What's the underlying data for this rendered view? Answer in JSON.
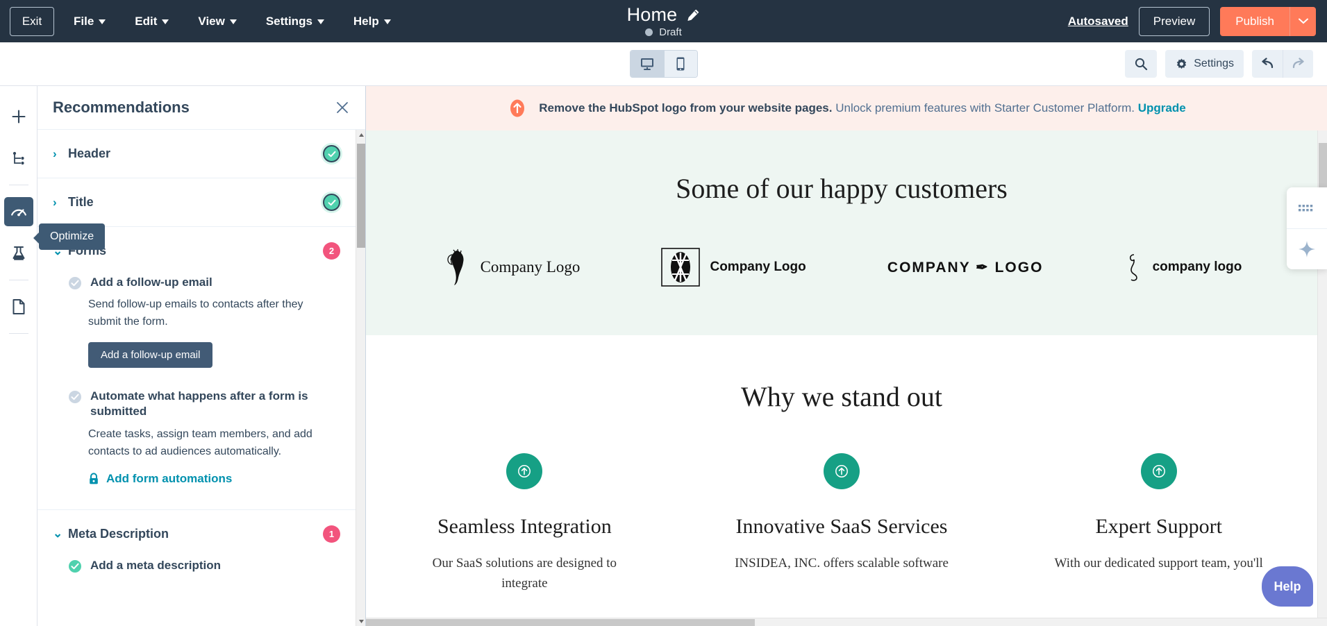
{
  "top_nav": {
    "exit_label": "Exit",
    "menus": [
      "File",
      "Edit",
      "View",
      "Settings",
      "Help"
    ],
    "page_title": "Home",
    "status": "Draft",
    "autosaved_label": "Autosaved",
    "preview_label": "Preview",
    "publish_label": "Publish"
  },
  "toolbar": {
    "device_desktop": "desktop-view",
    "device_mobile": "mobile-view",
    "settings_label": "Settings"
  },
  "rail": {
    "items": [
      "add-icon",
      "site-tree-icon",
      "optimize-gauge-icon",
      "ab-test-flask-icon",
      "file-icon"
    ]
  },
  "tooltip": {
    "optimize": "Optimize"
  },
  "recommendations": {
    "title": "Recommendations",
    "sections": [
      {
        "name": "Header",
        "state": "complete",
        "expanded": false
      },
      {
        "name": "Title",
        "state": "complete",
        "expanded": false
      },
      {
        "name": "Forms",
        "state": "badge",
        "badge": "2",
        "expanded": true
      },
      {
        "name": "Meta Description",
        "state": "badge",
        "badge": "1",
        "expanded": true
      }
    ],
    "forms_items": [
      {
        "title": "Add a follow-up email",
        "description": "Send follow-up emails to contacts after they submit the form.",
        "cta": "Add a follow-up email"
      },
      {
        "title": "Automate what happens after a form is submitted",
        "description": "Create tasks, assign team members, and add contacts to ad audiences automatically.",
        "link": "Add form automations"
      }
    ],
    "meta_items": [
      {
        "title": "Add a meta description"
      }
    ]
  },
  "alert": {
    "bold": "Remove the HubSpot logo from your website pages.",
    "rest": " Unlock premium features with Starter Customer Platform. ",
    "link": "Upgrade"
  },
  "page_content": {
    "customers_heading": "Some of our happy customers",
    "logos": [
      {
        "label": "Company Logo",
        "style": "serif",
        "mark": "lion-head-logo"
      },
      {
        "label": "Company Logo",
        "style": "bold",
        "mark": "boxed-diamond-logo"
      },
      {
        "label": "COMPANY ✒ LOGO",
        "style": "caps",
        "mark": "condensed-caps-logo"
      },
      {
        "label": "company logo",
        "style": "bold",
        "mark": "swan-line-logo"
      }
    ],
    "stand_out_heading": "Why we stand out",
    "features": [
      {
        "icon": "arrow-up-circle-icon",
        "title": "Seamless Integration",
        "body": "Our SaaS solutions are designed to integrate"
      },
      {
        "icon": "arrow-up-circle-icon",
        "title": "Innovative SaaS Services",
        "body": "INSIDEA, INC. offers scalable software"
      },
      {
        "icon": "arrow-up-circle-icon",
        "title": "Expert Support",
        "body": "With our dedicated support team, you'll"
      }
    ]
  },
  "float_tools": {
    "items": [
      "grid-dots-icon",
      "ai-sparkle-icon"
    ]
  },
  "help": {
    "label": "Help"
  },
  "colors": {
    "nav_bg": "#253342",
    "publish": "#ff7a59",
    "accent_teal": "#0091ae",
    "badge_pink": "#f2547d",
    "check_green": "#4fd1ae",
    "alert_bg": "#fdefeb",
    "feature_green": "#16a085",
    "help_purple": "#6a78d1"
  }
}
